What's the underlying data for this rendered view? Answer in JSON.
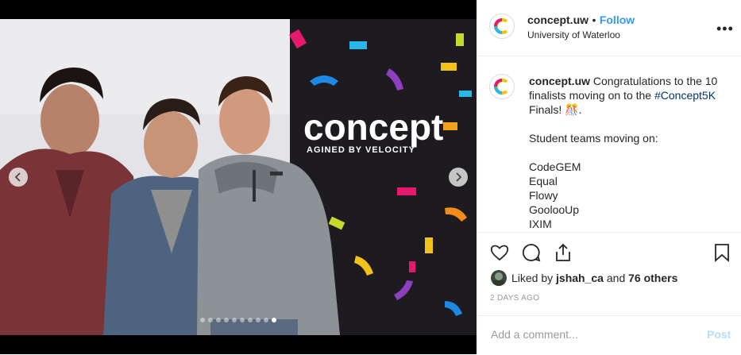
{
  "post": {
    "account": "concept.uw",
    "follow_separator": "•",
    "follow_label": "Follow",
    "location": "University of Waterloo",
    "more_label": "•••",
    "caption": {
      "username": "concept.uw",
      "intro": "Congratulations to the 10 finalists moving on to the",
      "hashtag": "#Concept5K",
      "finals": "Finals!",
      "emoji": "🎊",
      "period": ".",
      "teams_heading": "Student teams moving on:",
      "teams": [
        "CodeGEM",
        "Equal",
        "Flowy",
        "GoolooUp",
        "IXIM"
      ]
    },
    "likes": {
      "prefix": "Liked by",
      "user": "jshah_ca",
      "and": "and",
      "others": "76 others"
    },
    "timestamp": "2 DAYS AGO",
    "comment": {
      "placeholder": "Add a comment...",
      "post_label": "Post"
    }
  },
  "photo": {
    "wall_text": "concept",
    "wall_subtext": "AGINED BY VELOCITY",
    "slide_count": 10,
    "active_slide": 9
  },
  "colors": {
    "link_blue": "#3897f0",
    "hashtag_blue": "#003569",
    "post_disabled": "#b2dffc",
    "muted": "#999999"
  }
}
